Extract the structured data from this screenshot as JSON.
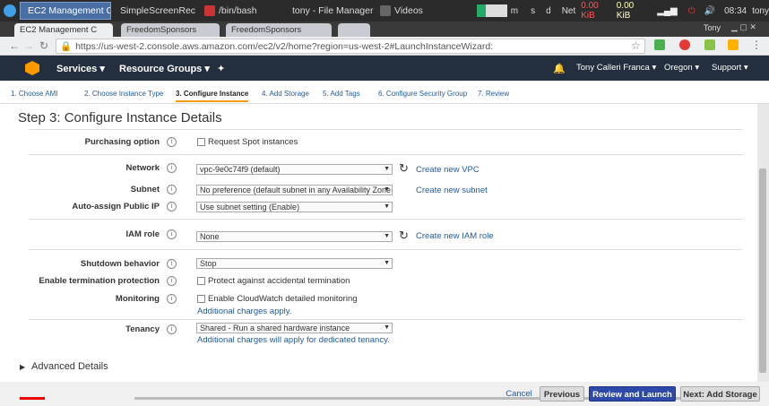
{
  "taskbar": {
    "apps": [
      {
        "label": "EC2 Management C",
        "active": true
      },
      {
        "label": "SimpleScreenRec"
      },
      {
        "label": "/bin/bash"
      },
      {
        "label": "tony - File Manager"
      },
      {
        "label": "Videos"
      }
    ],
    "tray": {
      "m": "m",
      "s": "s",
      "d": "d",
      "net": "Net",
      "down": "0.00 KiB",
      "up": "0.00 KiB",
      "time": "08:34",
      "user": "tony"
    }
  },
  "browser": {
    "tabs": [
      {
        "label": "EC2 Management C"
      },
      {
        "label": "FreedomSponsors"
      },
      {
        "label": "FreedomSponsors"
      }
    ],
    "user": "Tony",
    "url": "https://us-west-2.console.aws.amazon.com/ec2/v2/home?region=us-west-2#LaunchInstanceWizard:"
  },
  "aws": {
    "services": "Services",
    "resource_groups": "Resource Groups",
    "user": "Tony Calleri Franca",
    "region": "Oregon",
    "support": "Support"
  },
  "wizard": [
    "1. Choose AMI",
    "2. Choose Instance Type",
    "3. Configure Instance",
    "4. Add Storage",
    "5. Add Tags",
    "6. Configure Security Group",
    "7. Review"
  ],
  "page": {
    "title": "Step 3: Configure Instance Details"
  },
  "form": {
    "purchasing": {
      "label": "Purchasing option",
      "check": "Request Spot instances"
    },
    "network": {
      "label": "Network",
      "value": "vpc-9e0c74f9 (default)",
      "link": "Create new VPC"
    },
    "subnet": {
      "label": "Subnet",
      "value": "No preference (default subnet in any Availability Zone",
      "link": "Create new subnet"
    },
    "public_ip": {
      "label": "Auto-assign Public IP",
      "value": "Use subnet setting (Enable)"
    },
    "iam": {
      "label": "IAM role",
      "value": "None",
      "link": "Create new IAM role"
    },
    "shutdown": {
      "label": "Shutdown behavior",
      "value": "Stop"
    },
    "termination": {
      "label": "Enable termination protection",
      "check": "Protect against accidental termination"
    },
    "monitoring": {
      "label": "Monitoring",
      "check": "Enable CloudWatch detailed monitoring",
      "note": "Additional charges apply."
    },
    "tenancy": {
      "label": "Tenancy",
      "value": "Shared - Run a shared hardware instance",
      "note": "Additional charges will apply for dedicated tenancy."
    },
    "advanced": "Advanced Details"
  },
  "footer": {
    "cancel": "Cancel",
    "previous": "Previous",
    "review": "Review and Launch",
    "next": "Next: Add Storage"
  }
}
